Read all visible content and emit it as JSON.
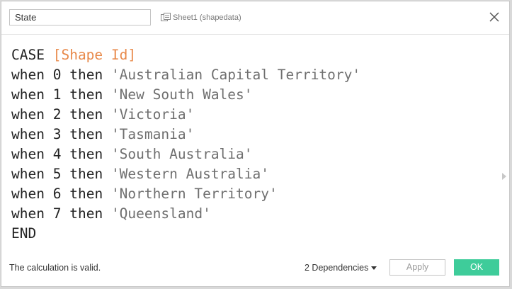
{
  "dialog": {
    "calc_name": "State",
    "datasource_label": "Sheet1 (shapedata)",
    "datasource_icon": "datasource-icon",
    "close_icon": "close-icon"
  },
  "formula": {
    "lines": [
      {
        "k1": "CASE",
        "sp": " ",
        "field": "[Shape Id]"
      },
      {
        "k1": "when",
        "n": "0",
        "k2": "then",
        "str": "'Australian Capital Territory'"
      },
      {
        "k1": "when",
        "n": "1",
        "k2": "then",
        "str": "'New South Wales'"
      },
      {
        "k1": "when",
        "n": "2",
        "k2": "then",
        "str": "'Victoria'"
      },
      {
        "k1": "when",
        "n": "3",
        "k2": "then",
        "str": "'Tasmania'"
      },
      {
        "k1": "when",
        "n": "4",
        "k2": "then",
        "str": "'South Australia'"
      },
      {
        "k1": "when",
        "n": "5",
        "k2": "then",
        "str": "'Western Australia'"
      },
      {
        "k1": "when",
        "n": "6",
        "k2": "then",
        "str": "'Northern Territory'"
      },
      {
        "k1": "when",
        "n": "7",
        "k2": "then",
        "str": "'Queensland'"
      },
      {
        "k1": "END"
      }
    ],
    "colors": {
      "keyword": "#222222",
      "field": "#e8894a",
      "string": "#6f6f6f"
    }
  },
  "footer": {
    "status": "The calculation is valid.",
    "dependencies_label": "2 Dependencies",
    "apply_label": "Apply",
    "ok_label": "OK",
    "ok_color": "#3ecc9a"
  }
}
